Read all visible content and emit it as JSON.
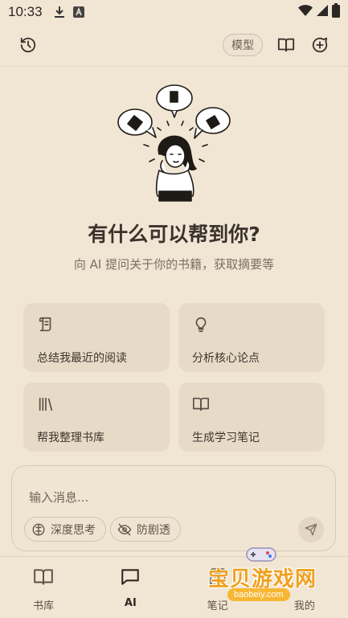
{
  "status_bar": {
    "time": "10:33",
    "icons": [
      "download-icon",
      "app-notification-icon",
      "wifi-icon",
      "signal-icon",
      "battery-icon"
    ]
  },
  "top_bar": {
    "model_label": "模型",
    "icons": [
      "history-icon",
      "book-open-icon",
      "new-chat-icon"
    ]
  },
  "hero": {
    "title": "有什么可以帮到你?",
    "subtitle": "向 AI 提问关于你的书籍，获取摘要等"
  },
  "suggestions": [
    {
      "label": "总结我最近的阅读",
      "icon": "scroll-icon"
    },
    {
      "label": "分析核心论点",
      "icon": "lightbulb-icon"
    },
    {
      "label": "帮我整理书库",
      "icon": "bookshelf-icon"
    },
    {
      "label": "生成学习笔记",
      "icon": "book-open-icon"
    }
  ],
  "composer": {
    "placeholder": "输入消息...",
    "deep_think_label": "深度思考",
    "anti_spoiler_label": "防剧透",
    "send_icon": "send-icon"
  },
  "bottom_nav": {
    "items": [
      {
        "label": "书库",
        "icon": "book-open-icon",
        "active": false
      },
      {
        "label": "AI",
        "icon": "chat-bubble-icon",
        "active": true
      },
      {
        "label": "笔记",
        "icon": "notes-icon",
        "active": false
      },
      {
        "label": "我的",
        "icon": "profile-icon",
        "active": false
      }
    ]
  },
  "watermark": {
    "text": "宝贝游戏网",
    "url": "baobeiy.com"
  },
  "colors": {
    "background": "#f1e6d4",
    "card": "#e7dbc8",
    "text": "#3a332c",
    "muted": "#7a6f63",
    "watermark": "#f0a01e"
  }
}
